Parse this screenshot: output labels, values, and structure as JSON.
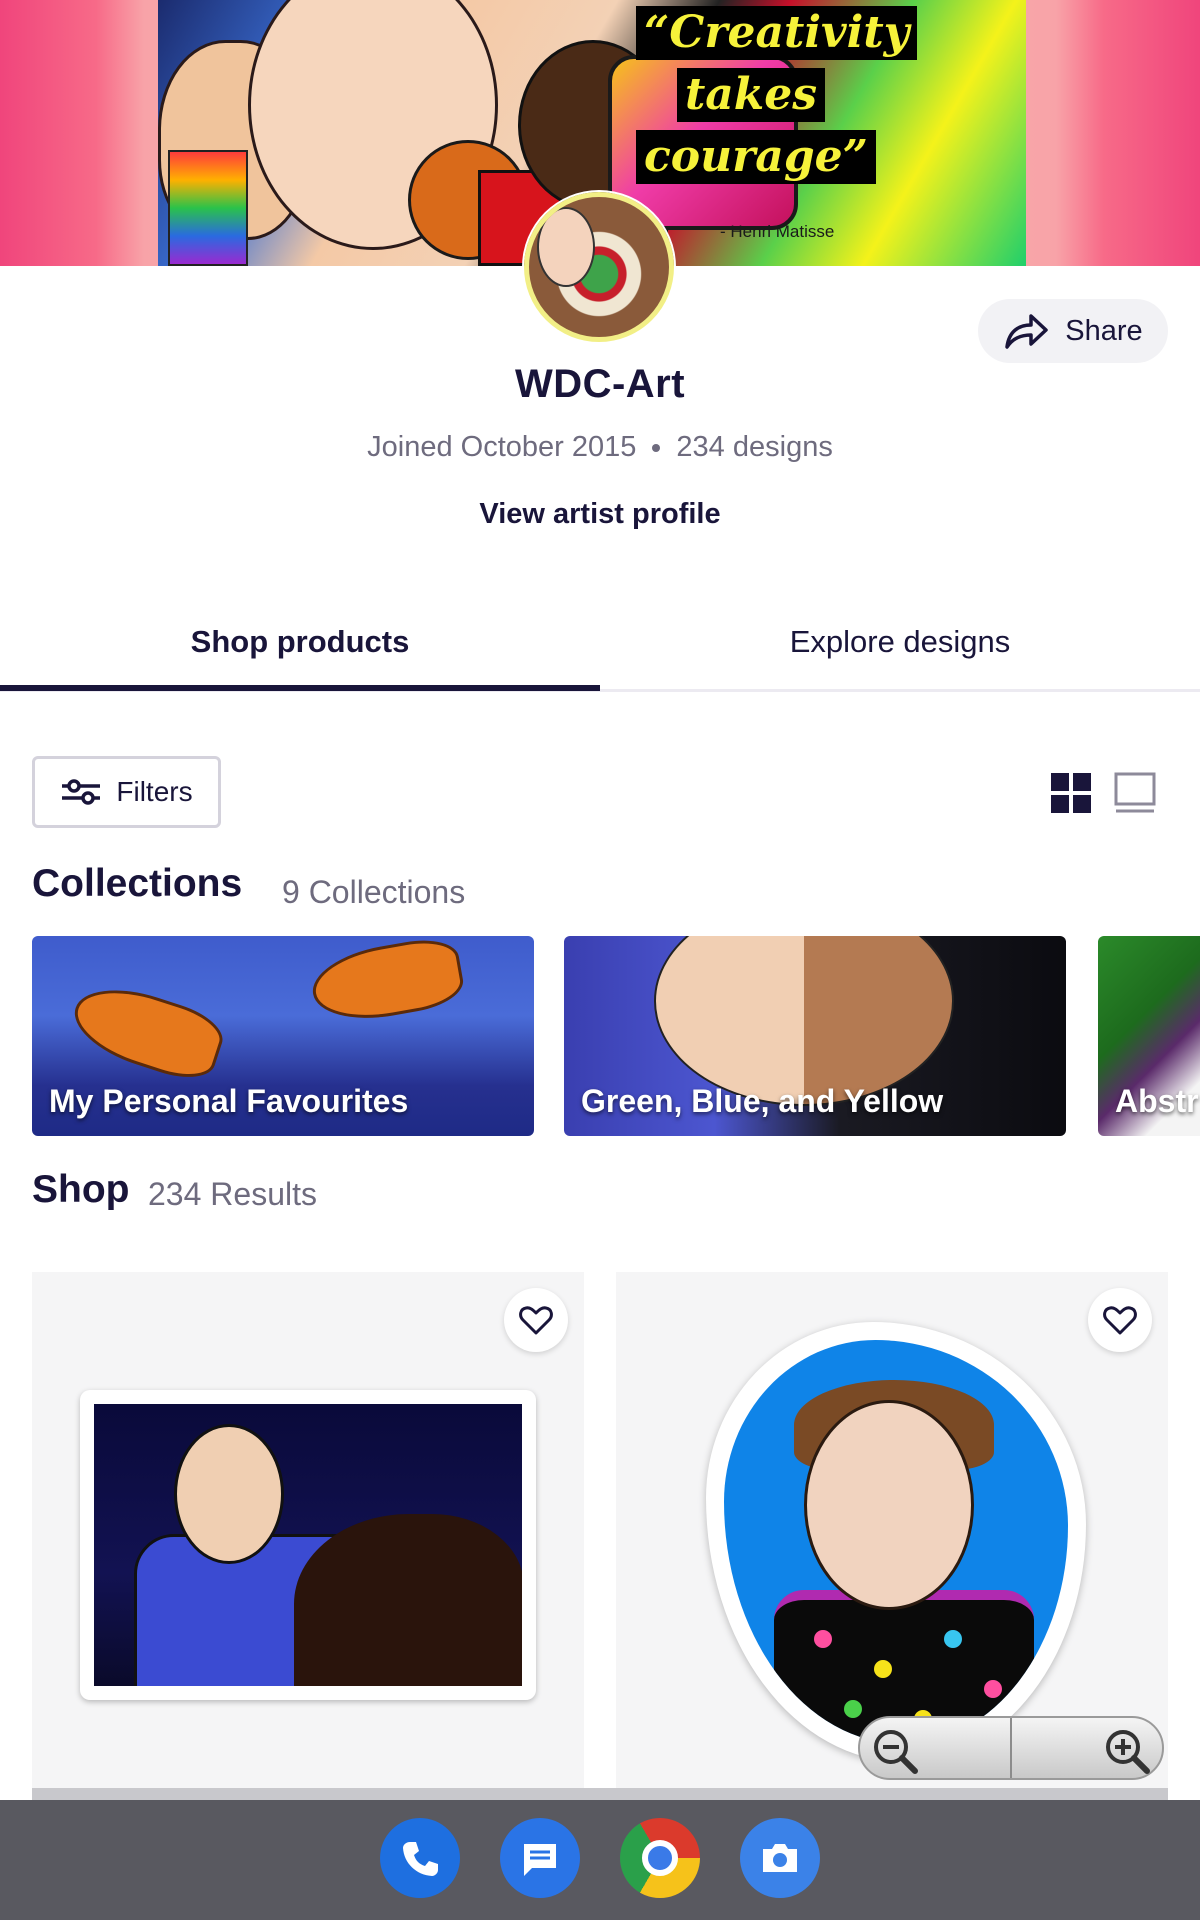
{
  "banner": {
    "quote_lines": [
      "“Creativity",
      "takes",
      "courage”"
    ],
    "quote_author": "- Henri Matisse"
  },
  "profile": {
    "name": "WDC-Art",
    "joined": "Joined October 2015",
    "designs": "234 designs",
    "view_profile": "View artist profile",
    "share_label": "Share"
  },
  "tabs": [
    {
      "label": "Shop products",
      "active": true
    },
    {
      "label": "Explore designs",
      "active": false
    }
  ],
  "toolbar": {
    "filters_label": "Filters",
    "view_icons": [
      "grid-view-icon",
      "single-view-icon"
    ]
  },
  "collections": {
    "title": "Collections",
    "count": "9 Collections",
    "items": [
      {
        "label": "My Personal Favourites"
      },
      {
        "label": "Green, Blue, and Yellow"
      },
      {
        "label": "Abstr"
      }
    ]
  },
  "shop": {
    "title": "Shop",
    "count": "234 Results"
  },
  "colors": {
    "primary_text": "#19153a",
    "muted_text": "#6e6b7e",
    "tab_underline": "#19153a"
  },
  "dock": {
    "apps": [
      "phone-icon",
      "messages-icon",
      "chrome-icon",
      "camera-icon"
    ]
  }
}
